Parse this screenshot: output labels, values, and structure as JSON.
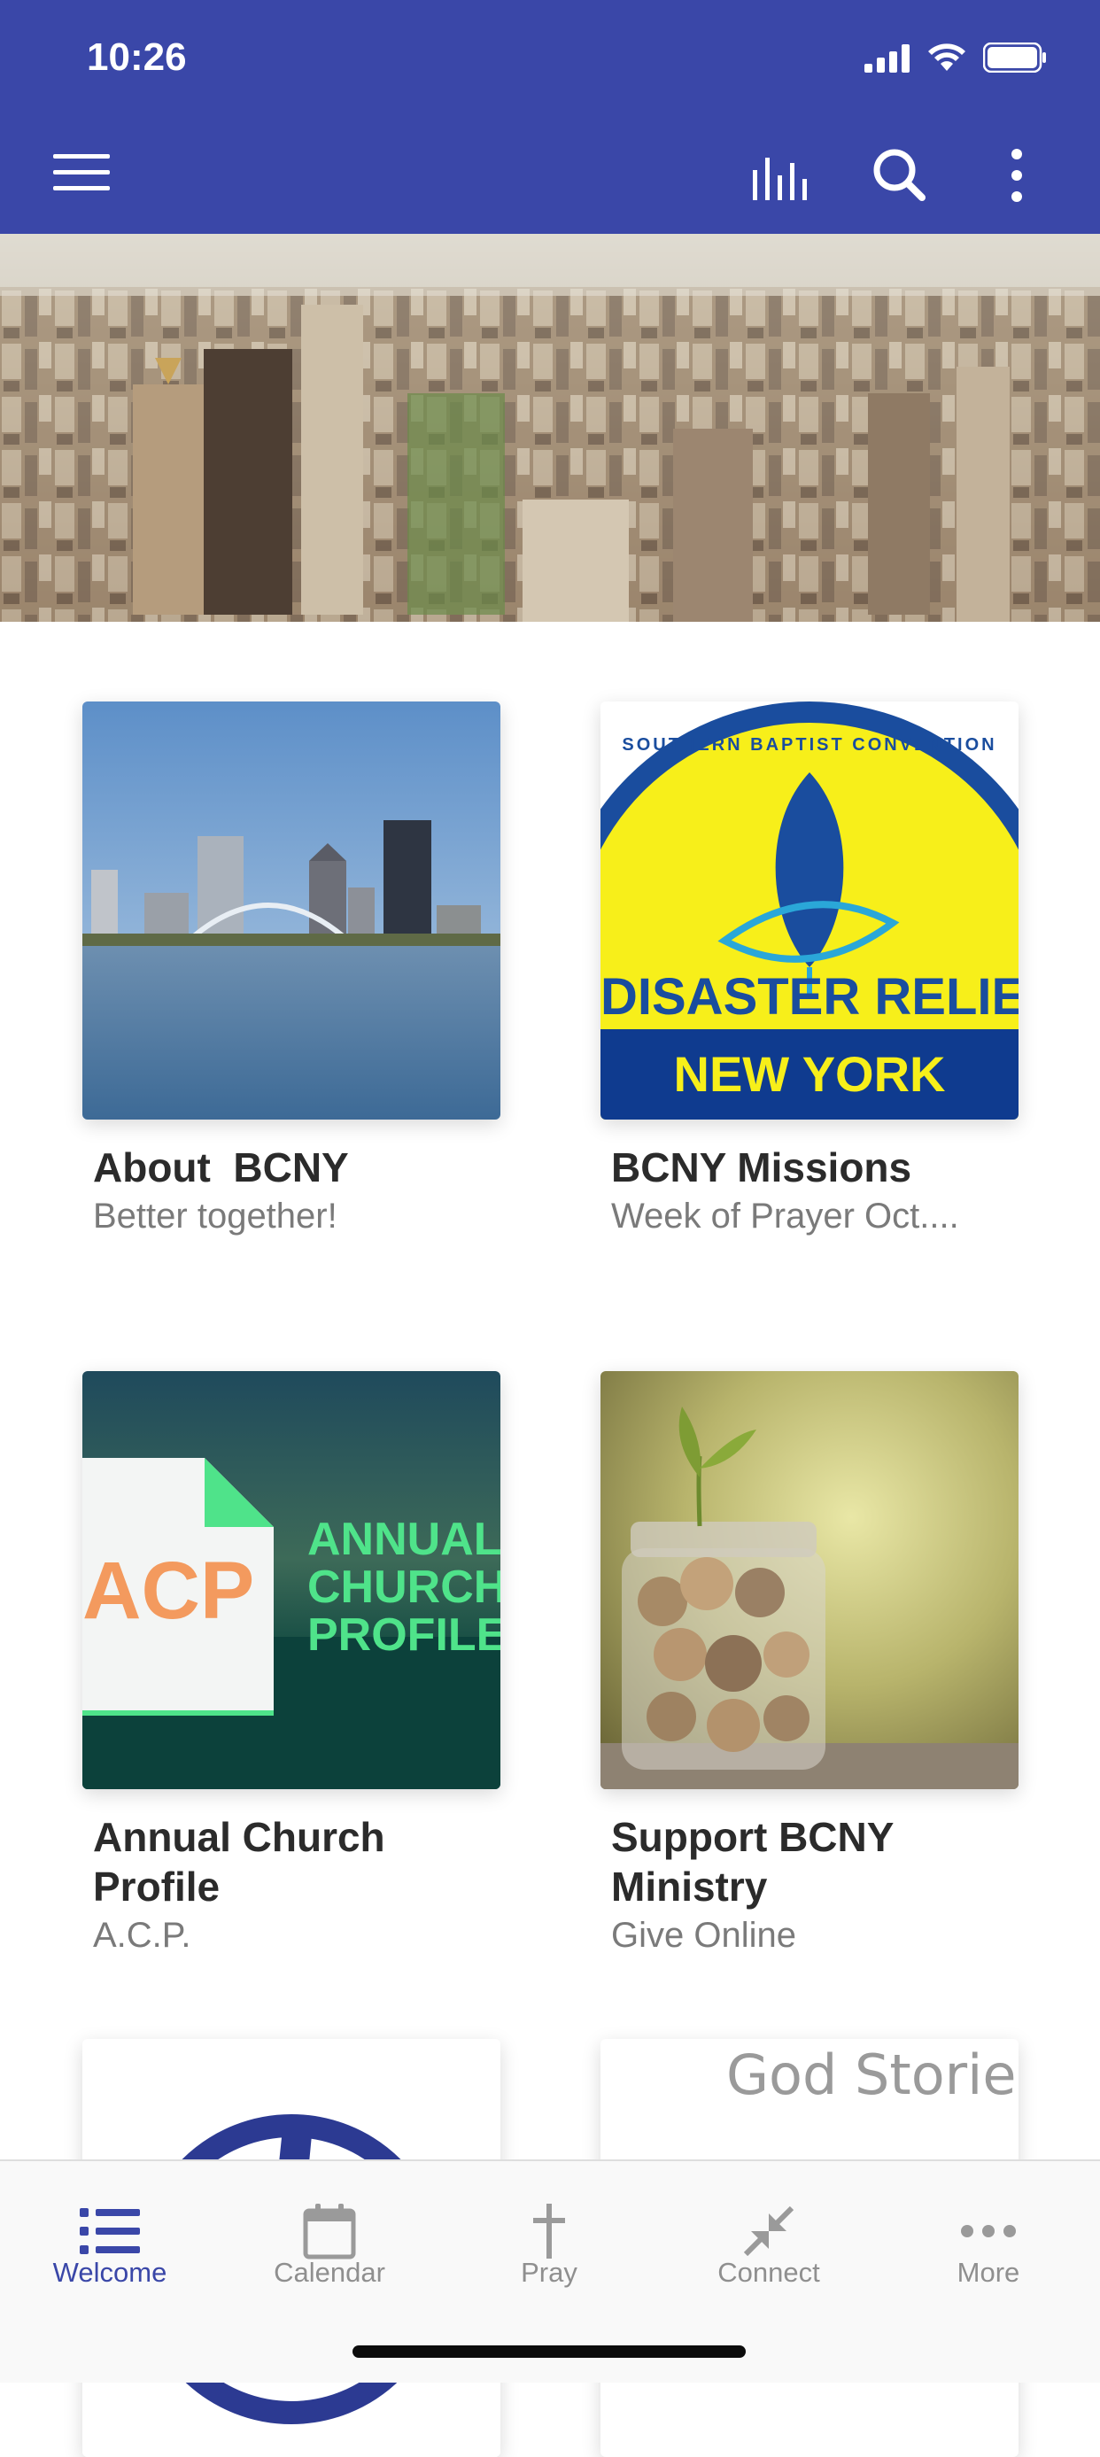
{
  "status_bar": {
    "time": "10:26"
  },
  "toolbar": {
    "menu_icon": "hamburger-icon",
    "stats_icon": "bar-chart-icon",
    "search_icon": "search-icon",
    "more_icon": "vertical-dots-icon",
    "color": "#3a47a8"
  },
  "hero": {
    "icon": "city-skyline-photo"
  },
  "cards": [
    {
      "title": "About  BCNY",
      "subtitle": "Better together!"
    },
    {
      "title": "BCNY Missions",
      "subtitle": "Week of Prayer Oct....",
      "logo": {
        "arc_text": "SOUTHERN BAPTIST CONVENTION",
        "main": "DISASTER RELIEF",
        "region": "NEW YORK"
      }
    },
    {
      "title": "Annual Church Profile",
      "subtitle": "A.C.P.",
      "logo": {
        "abbr": "ACP",
        "line1": "ANNUAL",
        "line2": "CHURCH",
        "line3": "PROFILE"
      }
    },
    {
      "title": "Support BCNY Ministry",
      "subtitle": "Give Online"
    },
    {
      "title": "",
      "subtitle": ""
    },
    {
      "title": "",
      "subtitle": "",
      "image_text": "God Stories"
    }
  ],
  "tabs": [
    {
      "label": "Welcome",
      "icon": "list-icon",
      "active": true
    },
    {
      "label": "Calendar",
      "icon": "calendar-icon",
      "active": false
    },
    {
      "label": "Pray",
      "icon": "cross-icon",
      "active": false
    },
    {
      "label": "Connect",
      "icon": "connect-arrows-icon",
      "active": false
    },
    {
      "label": "More",
      "icon": "more-dots-icon",
      "active": false
    }
  ]
}
